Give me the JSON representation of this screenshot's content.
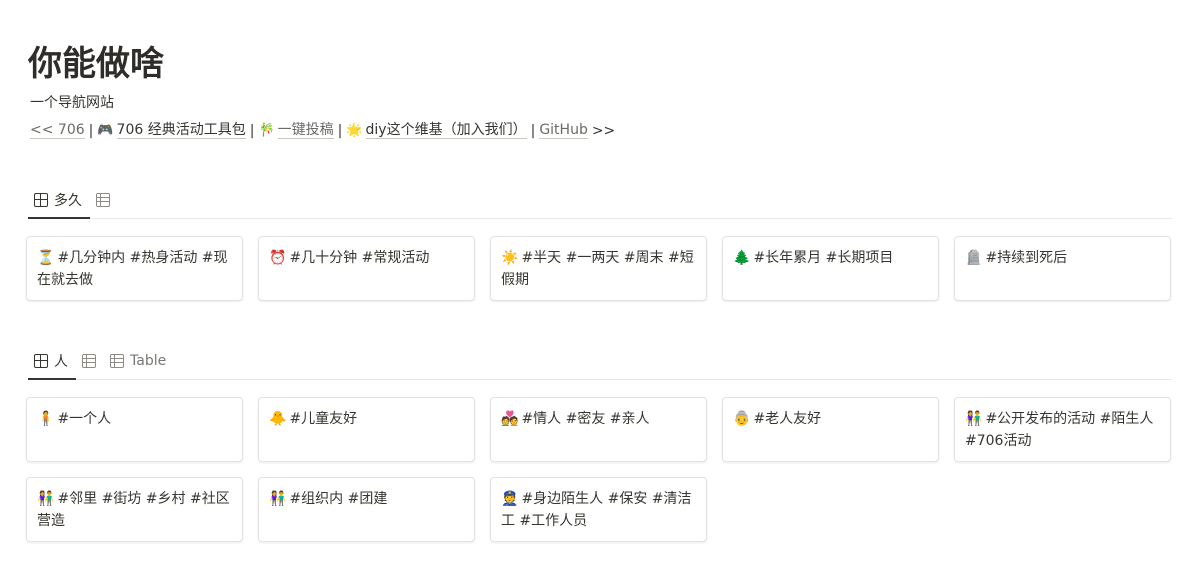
{
  "page": {
    "title": "你能做啥",
    "subtitle": "一个导航网站"
  },
  "links": {
    "prev": "<< 706",
    "sep": "|",
    "toolkit_icon": "🎮",
    "toolkit": "706 经典活动工具包",
    "submit_icon": "🎋",
    "submit": "一键投稿",
    "wiki_icon": "🌟",
    "wiki": "diy这个维基（加入我们）",
    "github": "GitHub",
    "next": ">>"
  },
  "section_duration": {
    "tabs": [
      {
        "label": "多久",
        "icon": "gallery-icon",
        "active": true
      },
      {
        "label": "",
        "icon": "table-icon",
        "active": false
      }
    ],
    "cards": [
      {
        "emoji": "⏳",
        "text": "#几分钟内 #热身活动 #现在就去做"
      },
      {
        "emoji": "⏰",
        "text": "#几十分钟 #常规活动"
      },
      {
        "emoji": "☀️",
        "text": "#半天 #一两天 #周末 #短假期"
      },
      {
        "emoji": "🌲",
        "text": "#长年累月 #长期项目"
      },
      {
        "emoji": "🪦",
        "text": "#持续到死后"
      }
    ]
  },
  "section_people": {
    "tabs": [
      {
        "label": "人",
        "icon": "gallery-icon",
        "active": true
      },
      {
        "label": "",
        "icon": "table-icon",
        "active": false
      },
      {
        "label": "Table",
        "icon": "table-icon",
        "active": false
      }
    ],
    "cards": [
      {
        "emoji": "🧍",
        "text": "#一个人"
      },
      {
        "emoji": "🐥",
        "text": "#儿童友好"
      },
      {
        "emoji": "💑",
        "text": "#情人 #密友 #亲人"
      },
      {
        "emoji": "👵",
        "text": "#老人友好"
      },
      {
        "emoji": "👫",
        "text": "#公开发布的活动 #陌生人 #706活动"
      },
      {
        "emoji": "👫",
        "text": "#邻里 #街坊 #乡村 #社区营造"
      },
      {
        "emoji": "👫",
        "text": "#组织内 #团建"
      },
      {
        "emoji": "👮",
        "text": "#身边陌生人 #保安 #清洁工 #工作人员"
      }
    ]
  }
}
